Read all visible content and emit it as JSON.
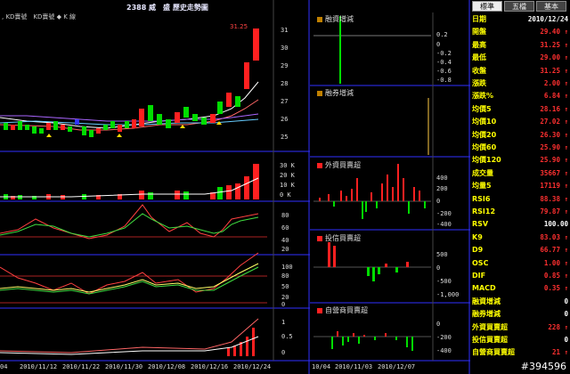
{
  "header": {
    "title": "2388 威　盛 歷史走勢圖",
    "legend": ", KD賣號　KD賣號 ◆ K 線"
  },
  "main_chart": {
    "price_max_label": "31.25",
    "price_ticks": [
      "31",
      "30",
      "29",
      "28",
      "27",
      "26",
      "25"
    ],
    "volume_ticks": [
      "30 K",
      "20 K",
      "10 K",
      "0 K"
    ],
    "kd_ticks": [
      "80",
      "60",
      "40",
      "20"
    ],
    "rsi_ticks": [
      "100",
      "80",
      "50",
      "20",
      "0"
    ],
    "macd_ticks": [
      "1",
      "0.5",
      "0"
    ],
    "x_labels": [
      "04",
      "2010/11/12",
      "2010/11/22",
      "2010/11/30",
      "2010/12/08",
      "2010/12/16",
      "2010/12/24"
    ]
  },
  "sub_panels": [
    {
      "title": "融資增減",
      "color": "#c08000",
      "ticks": [
        "0.2",
        "0",
        "-0.2",
        "-0.4",
        "-0.6",
        "-0.8"
      ]
    },
    {
      "title": "融券增減",
      "color": "#c08000",
      "ticks": []
    },
    {
      "title": "外資買賣超",
      "color": "#ff2020",
      "ticks": [
        "400",
        "200",
        "0",
        "-200",
        "-400"
      ]
    },
    {
      "title": "投信買賣超",
      "color": "#ff2020",
      "ticks": [
        "500",
        "0",
        "-500",
        "-1,000"
      ]
    },
    {
      "title": "自營商買賣超",
      "color": "#ff2020",
      "ticks": [
        "0",
        "-200",
        "-400"
      ]
    }
  ],
  "sub_x_labels": [
    "10/04",
    "2010/11/03",
    "2010/12/07"
  ],
  "tabs": [
    {
      "label": "標準",
      "active": true
    },
    {
      "label": "五檔",
      "active": false
    },
    {
      "label": "基本",
      "active": false
    }
  ],
  "quote": [
    {
      "k": "日期",
      "v": "2010/12/24",
      "c": "#ffffff"
    },
    {
      "k": "開盤",
      "v": "29.40 ↑",
      "c": "#ff3030"
    },
    {
      "k": "最高",
      "v": "31.25 ↑",
      "c": "#ff3030"
    },
    {
      "k": "最低",
      "v": "29.00 ↑",
      "c": "#ff3030"
    },
    {
      "k": "收盤",
      "v": "31.25 ↑",
      "c": "#ff3030"
    },
    {
      "k": "漲跌",
      "v": "2.00 ↑",
      "c": "#ff3030"
    },
    {
      "k": "漲跌%",
      "v": "6.84 ↑",
      "c": "#ff3030"
    },
    {
      "k": "均價5",
      "v": "28.16 ↑",
      "c": "#ff3030"
    },
    {
      "k": "均價10",
      "v": "27.02 ↑",
      "c": "#ff3030"
    },
    {
      "k": "均價20",
      "v": "26.30 ↑",
      "c": "#ff3030"
    },
    {
      "k": "均價60",
      "v": "25.90 ↑",
      "c": "#ff3030"
    },
    {
      "k": "均價120",
      "v": "25.90 ↑",
      "c": "#ff3030"
    },
    {
      "k": "成交量",
      "v": "35667 ↑",
      "c": "#ff3030"
    },
    {
      "k": "均量5",
      "v": "17119 ↑",
      "c": "#ff3030"
    },
    {
      "k": "RSI6",
      "v": "88.38 ↑",
      "c": "#ff3030"
    },
    {
      "k": "RSI12",
      "v": "79.87 ↑",
      "c": "#ff3030"
    },
    {
      "k": "RSV",
      "v": "100.00",
      "c": "#ffffff"
    },
    {
      "k": "K9",
      "v": "83.03 ↑",
      "c": "#ff3030"
    },
    {
      "k": "D9",
      "v": "66.77 ↑",
      "c": "#ff3030"
    },
    {
      "k": "OSC",
      "v": "1.00 ↑",
      "c": "#ff3030"
    },
    {
      "k": "DIF",
      "v": "0.85 ↑",
      "c": "#ff3030"
    },
    {
      "k": "MACD",
      "v": "0.35 ↑",
      "c": "#ff3030"
    },
    {
      "k": "融資增減",
      "v": "0",
      "c": "#ffffff"
    },
    {
      "k": "融券增減",
      "v": "0",
      "c": "#ffffff"
    },
    {
      "k": "外資買賣超",
      "v": "228 ↑",
      "c": "#ff3030"
    },
    {
      "k": "投信買賣超",
      "v": "0",
      "c": "#ffffff"
    },
    {
      "k": "自營商買賣超",
      "v": "21 ↑",
      "c": "#ff3030"
    }
  ],
  "watermark": "#394596"
}
